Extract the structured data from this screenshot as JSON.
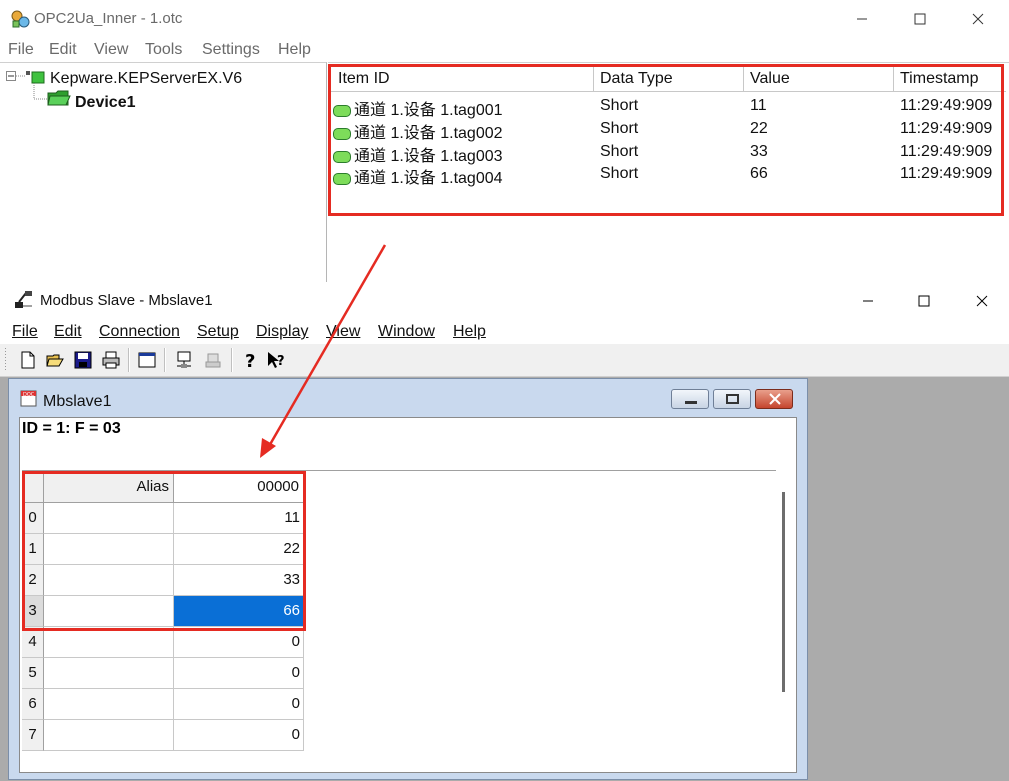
{
  "opc": {
    "title": "OPC2Ua_Inner - 1.otc",
    "menu": [
      "File",
      "Edit",
      "View",
      "Tools",
      "Settings",
      "Help"
    ],
    "tree": {
      "server": "Kepware.KEPServerEX.V6",
      "device": "Device1"
    },
    "columns": [
      "Item ID",
      "Data Type",
      "Value",
      "Timestamp"
    ],
    "rows": [
      {
        "item_id": "通道 1.设备 1.tag001",
        "data_type": "Short",
        "value": "11",
        "timestamp": "11:29:49:909"
      },
      {
        "item_id": "通道 1.设备 1.tag002",
        "data_type": "Short",
        "value": "22",
        "timestamp": "11:29:49:909"
      },
      {
        "item_id": "通道 1.设备 1.tag003",
        "data_type": "Short",
        "value": "33",
        "timestamp": "11:29:49:909"
      },
      {
        "item_id": "通道 1.设备 1.tag004",
        "data_type": "Short",
        "value": "66",
        "timestamp": "11:29:49:909"
      }
    ]
  },
  "modbus": {
    "title": "Modbus Slave - Mbslave1",
    "menu": [
      "File",
      "Edit",
      "Connection",
      "Setup",
      "Display",
      "View",
      "Window",
      "Help"
    ],
    "toolbar_icons": [
      "new-icon",
      "open-icon",
      "save-icon",
      "print-icon",
      "window-icon",
      "connect-icon",
      "disconnect-icon",
      "help-icon",
      "context-help-icon"
    ],
    "child": {
      "title": "Mbslave1",
      "status": "ID = 1: F = 03",
      "grid": {
        "alias_header": "Alias",
        "address_header": "00000",
        "rows": [
          {
            "index": "0",
            "alias": "",
            "value": "11"
          },
          {
            "index": "1",
            "alias": "",
            "value": "22"
          },
          {
            "index": "2",
            "alias": "",
            "value": "33"
          },
          {
            "index": "3",
            "alias": "",
            "value": "66"
          },
          {
            "index": "4",
            "alias": "",
            "value": "0"
          },
          {
            "index": "5",
            "alias": "",
            "value": "0"
          },
          {
            "index": "6",
            "alias": "",
            "value": "0"
          },
          {
            "index": "7",
            "alias": "",
            "value": "0"
          }
        ],
        "selected_row": 3
      }
    }
  },
  "colors": {
    "highlight": "#e52b22",
    "selection": "#0a6fd6"
  }
}
